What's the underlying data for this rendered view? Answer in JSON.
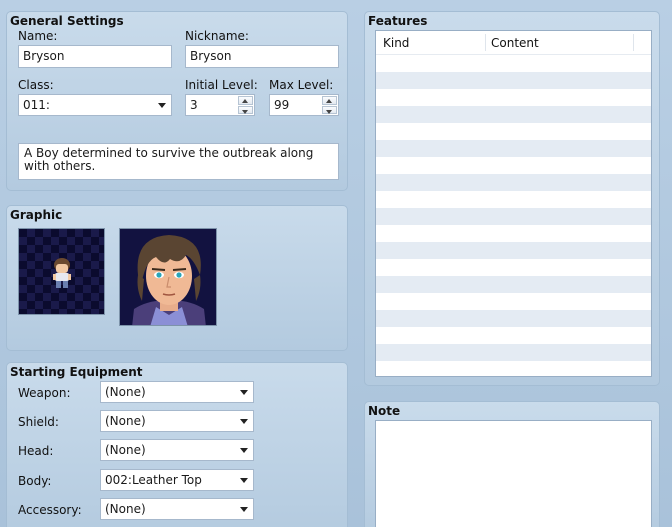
{
  "general": {
    "title": "General Settings",
    "name_label": "Name:",
    "name_value": "Bryson",
    "nickname_label": "Nickname:",
    "nickname_value": "Bryson",
    "class_label": "Class:",
    "class_value": "011:",
    "initial_level_label": "Initial Level:",
    "initial_level_value": "3",
    "max_level_label": "Max Level:",
    "max_level_value": "99",
    "description": "A Boy determined to survive the outbreak along with others."
  },
  "graphic": {
    "title": "Graphic"
  },
  "equipment": {
    "title": "Starting Equipment",
    "slots": [
      {
        "label": "Weapon:",
        "value": "(None)"
      },
      {
        "label": "Shield:",
        "value": "(None)"
      },
      {
        "label": "Head:",
        "value": "(None)"
      },
      {
        "label": "Body:",
        "value": "002:Leather Top"
      },
      {
        "label": "Accessory:",
        "value": "(None)"
      }
    ]
  },
  "features": {
    "title": "Features",
    "columns": [
      "Kind",
      "Content"
    ]
  },
  "note": {
    "title": "Note",
    "text": ""
  },
  "colors": {
    "row_alt": "#e4ebf3",
    "panel_bg": "#c9dbeb"
  }
}
